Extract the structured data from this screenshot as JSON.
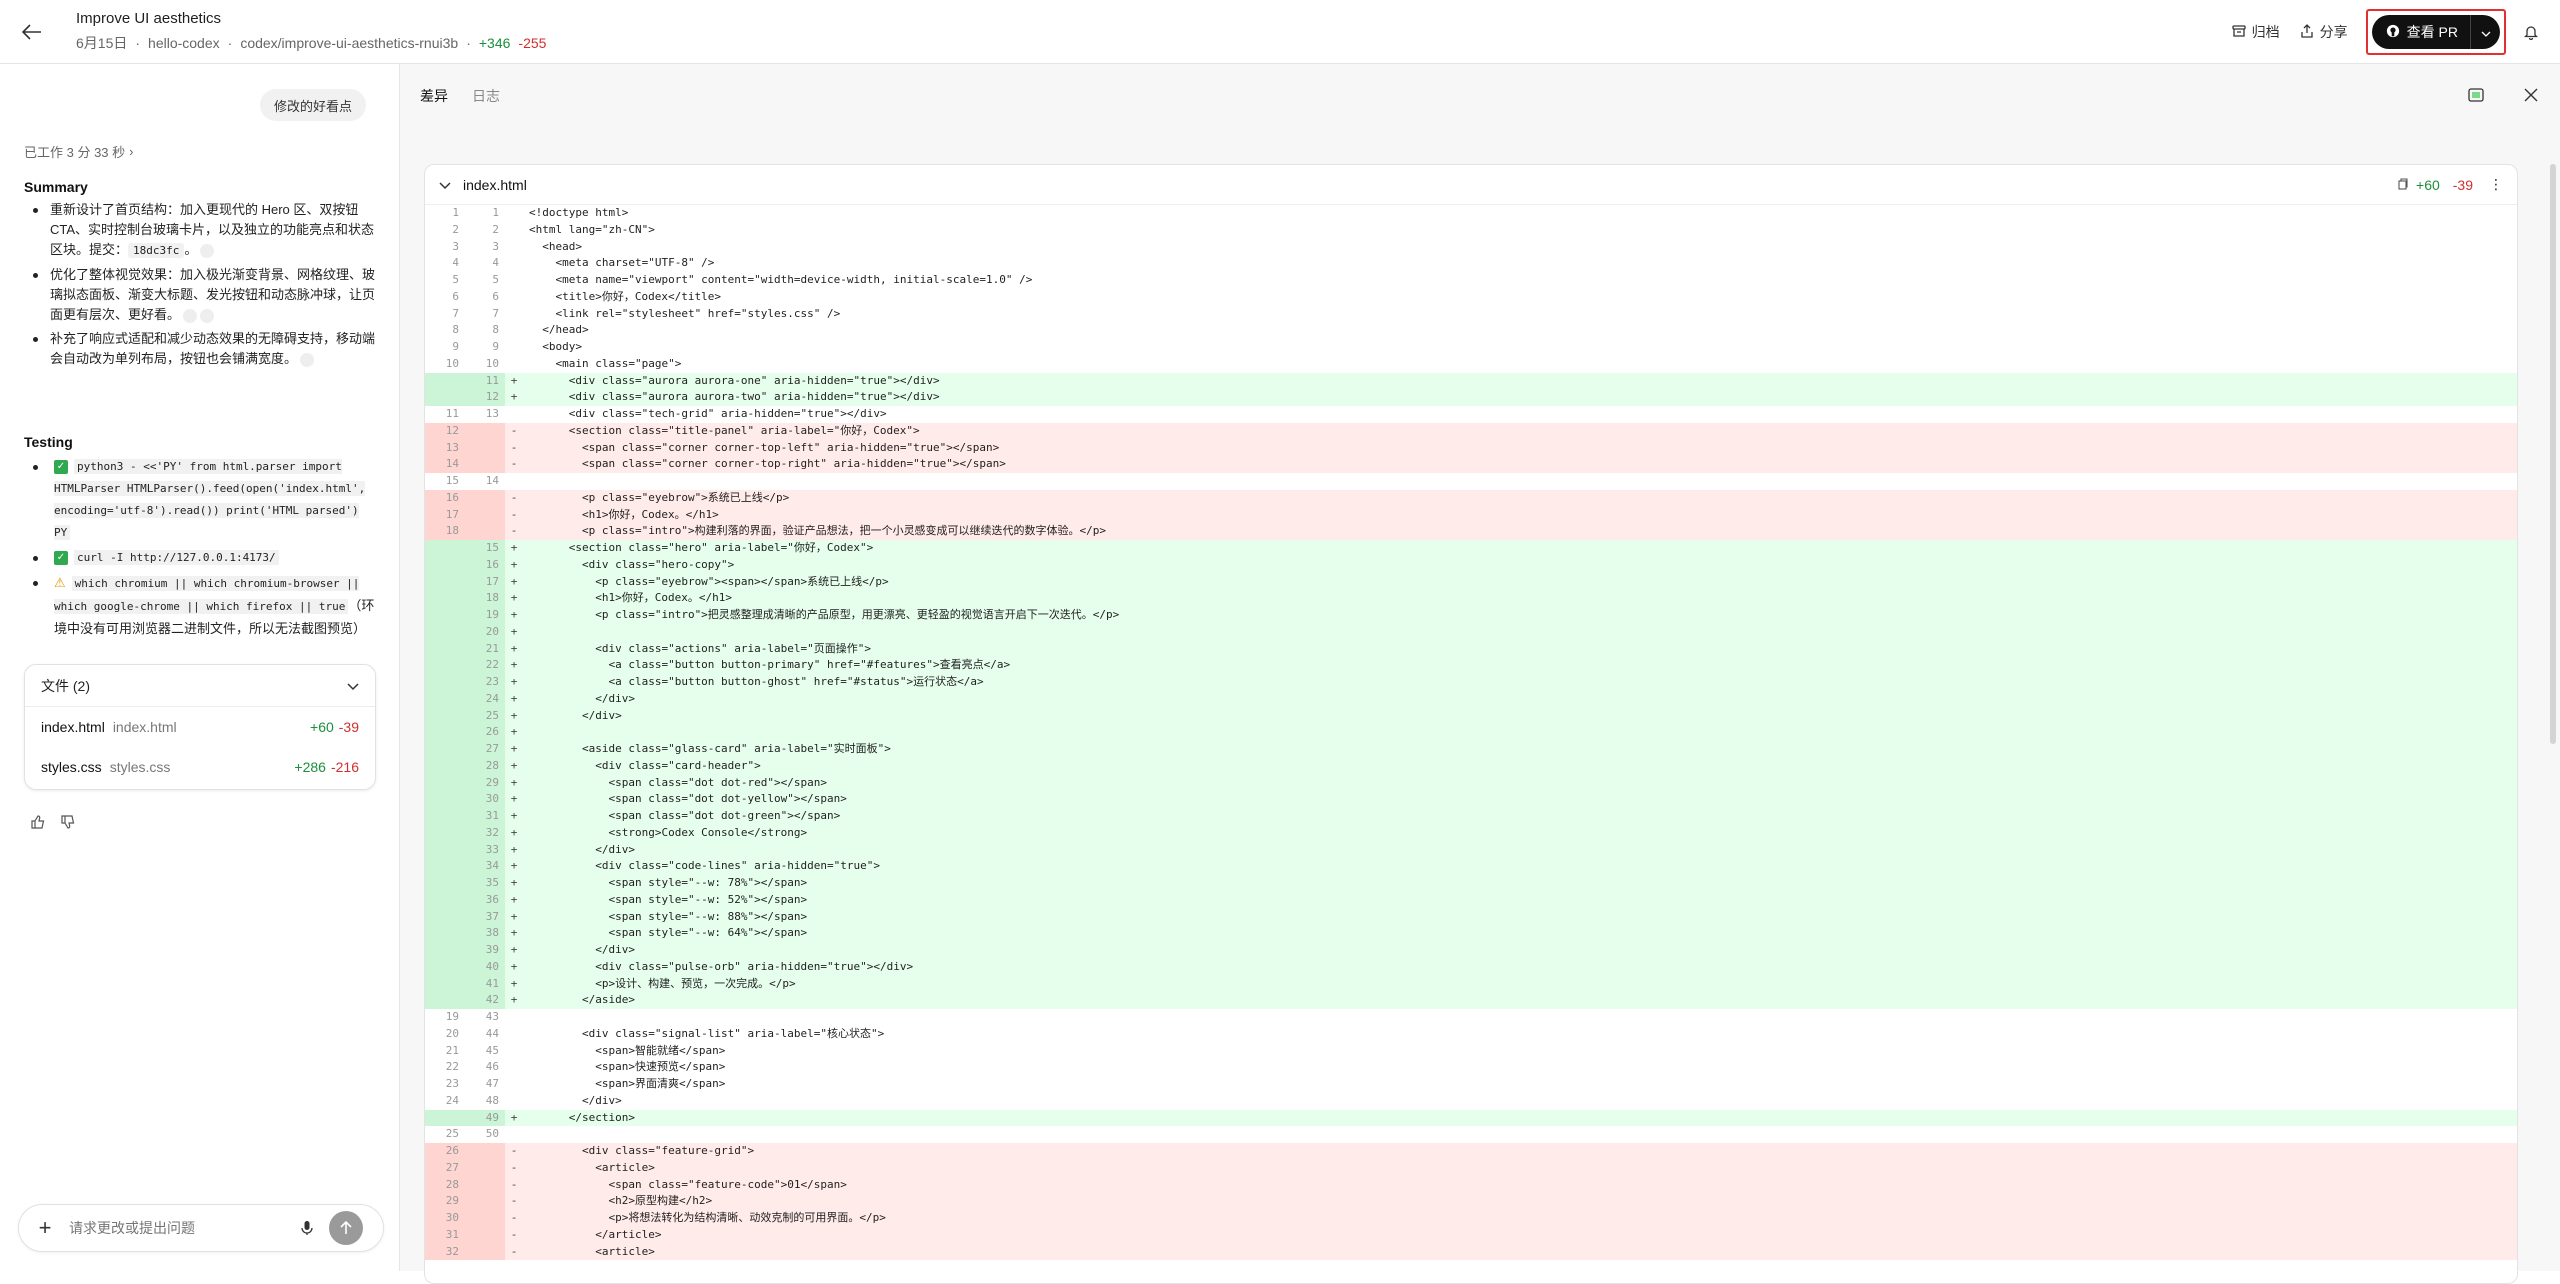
{
  "header": {
    "title": "Improve UI aesthetics",
    "date": "6月15日",
    "repo": "hello-codex",
    "branch": "codex/improve-ui-aesthetics-rnui3b",
    "additions": "+346",
    "deletions": "-255",
    "archive_label": "归档",
    "share_label": "分享",
    "pr_label": "查看 PR"
  },
  "left": {
    "prompt_chip": "修改的好看点",
    "worked": "已工作 3 分 33 秒",
    "summary_title": "Summary",
    "summary_items": [
      {
        "text": "重新设计了首页结构：加入更现代的 Hero 区、双按钮 CTA、实时控制台玻璃卡片，以及独立的功能亮点和状态区块。提交：",
        "code": "18dc3fc",
        "tail": "。"
      },
      {
        "text": "优化了整体视觉效果：加入极光渐变背景、网格纹理、玻璃拟态面板、渐变大标题、发光按钮和动态脉冲球，让页面更有层次、更好看。"
      },
      {
        "text": "补充了响应式适配和减少动态效果的无障碍支持，移动端会自动改为单列布局，按钮也会铺满宽度。"
      }
    ],
    "testing_title": "Testing",
    "testing_items": [
      {
        "status": "pass",
        "code": "python3 - <<'PY' from html.parser import HTMLParser HTMLParser().feed(open('index.html', encoding='utf-8').read()) print('HTML parsed') PY"
      },
      {
        "status": "pass",
        "code": "curl -I http://127.0.0.1:4173/"
      },
      {
        "status": "warn",
        "code": "which chromium || which chromium-browser || which google-chrome || which firefox || true",
        "note": "（环境中没有可用浏览器二进制文件，所以无法截图预览）"
      }
    ],
    "files_title": "文件 (2)",
    "files": [
      {
        "name": "index.html",
        "path": "index.html",
        "add": "+60",
        "del": "-39"
      },
      {
        "name": "styles.css",
        "path": "styles.css",
        "add": "+286",
        "del": "-216"
      }
    ],
    "composer_placeholder": "请求更改或提出问题"
  },
  "right": {
    "tabs": [
      "差异",
      "日志"
    ],
    "diff_file": "index.html",
    "diff_add": "+60",
    "diff_del": "-39",
    "lines": [
      {
        "t": "ctx",
        "a": "1",
        "b": "1",
        "c": "<!doctype html>"
      },
      {
        "t": "ctx",
        "a": "2",
        "b": "2",
        "c": "<html lang=\"zh-CN\">"
      },
      {
        "t": "ctx",
        "a": "3",
        "b": "3",
        "c": "  <head>"
      },
      {
        "t": "ctx",
        "a": "4",
        "b": "4",
        "c": "    <meta charset=\"UTF-8\" />"
      },
      {
        "t": "ctx",
        "a": "5",
        "b": "5",
        "c": "    <meta name=\"viewport\" content=\"width=device-width, initial-scale=1.0\" />"
      },
      {
        "t": "ctx",
        "a": "6",
        "b": "6",
        "c": "    <title>你好，Codex</title>"
      },
      {
        "t": "ctx",
        "a": "7",
        "b": "7",
        "c": "    <link rel=\"stylesheet\" href=\"styles.css\" />"
      },
      {
        "t": "ctx",
        "a": "8",
        "b": "8",
        "c": "  </head>"
      },
      {
        "t": "ctx",
        "a": "9",
        "b": "9",
        "c": "  <body>"
      },
      {
        "t": "ctx",
        "a": "10",
        "b": "10",
        "c": "    <main class=\"page\">"
      },
      {
        "t": "add",
        "a": "",
        "b": "11",
        "c": "      <div class=\"aurora aurora-one\" aria-hidden=\"true\"></div>"
      },
      {
        "t": "add",
        "a": "",
        "b": "12",
        "c": "      <div class=\"aurora aurora-two\" aria-hidden=\"true\"></div>"
      },
      {
        "t": "ctx",
        "a": "11",
        "b": "13",
        "c": "      <div class=\"tech-grid\" aria-hidden=\"true\"></div>"
      },
      {
        "t": "del",
        "a": "12",
        "b": "",
        "c": "      <section class=\"title-panel\" aria-label=\"你好，Codex\">"
      },
      {
        "t": "del",
        "a": "13",
        "b": "",
        "c": "        <span class=\"corner corner-top-left\" aria-hidden=\"true\"></span>"
      },
      {
        "t": "del",
        "a": "14",
        "b": "",
        "c": "        <span class=\"corner corner-top-right\" aria-hidden=\"true\"></span>"
      },
      {
        "t": "ctx",
        "a": "15",
        "b": "14",
        "c": ""
      },
      {
        "t": "del",
        "a": "16",
        "b": "",
        "c": "        <p class=\"eyebrow\">系统已上线</p>"
      },
      {
        "t": "del",
        "a": "17",
        "b": "",
        "c": "        <h1>你好，Codex。</h1>"
      },
      {
        "t": "del",
        "a": "18",
        "b": "",
        "c": "        <p class=\"intro\">构建利落的界面，验证产品想法，把一个小灵感变成可以继续迭代的数字体验。</p>"
      },
      {
        "t": "add",
        "a": "",
        "b": "15",
        "c": "      <section class=\"hero\" aria-label=\"你好，Codex\">"
      },
      {
        "t": "add",
        "a": "",
        "b": "16",
        "c": "        <div class=\"hero-copy\">"
      },
      {
        "t": "add",
        "a": "",
        "b": "17",
        "c": "          <p class=\"eyebrow\"><span></span>系统已上线</p>"
      },
      {
        "t": "add",
        "a": "",
        "b": "18",
        "c": "          <h1>你好，Codex。</h1>"
      },
      {
        "t": "add",
        "a": "",
        "b": "19",
        "c": "          <p class=\"intro\">把灵感整理成清晰的产品原型，用更漂亮、更轻盈的视觉语言开启下一次迭代。</p>"
      },
      {
        "t": "add",
        "a": "",
        "b": "20",
        "c": ""
      },
      {
        "t": "add",
        "a": "",
        "b": "21",
        "c": "          <div class=\"actions\" aria-label=\"页面操作\">"
      },
      {
        "t": "add",
        "a": "",
        "b": "22",
        "c": "            <a class=\"button button-primary\" href=\"#features\">查看亮点</a>"
      },
      {
        "t": "add",
        "a": "",
        "b": "23",
        "c": "            <a class=\"button button-ghost\" href=\"#status\">运行状态</a>"
      },
      {
        "t": "add",
        "a": "",
        "b": "24",
        "c": "          </div>"
      },
      {
        "t": "add",
        "a": "",
        "b": "25",
        "c": "        </div>"
      },
      {
        "t": "add",
        "a": "",
        "b": "26",
        "c": ""
      },
      {
        "t": "add",
        "a": "",
        "b": "27",
        "c": "        <aside class=\"glass-card\" aria-label=\"实时面板\">"
      },
      {
        "t": "add",
        "a": "",
        "b": "28",
        "c": "          <div class=\"card-header\">"
      },
      {
        "t": "add",
        "a": "",
        "b": "29",
        "c": "            <span class=\"dot dot-red\"></span>"
      },
      {
        "t": "add",
        "a": "",
        "b": "30",
        "c": "            <span class=\"dot dot-yellow\"></span>"
      },
      {
        "t": "add",
        "a": "",
        "b": "31",
        "c": "            <span class=\"dot dot-green\"></span>"
      },
      {
        "t": "add",
        "a": "",
        "b": "32",
        "c": "            <strong>Codex Console</strong>"
      },
      {
        "t": "add",
        "a": "",
        "b": "33",
        "c": "          </div>"
      },
      {
        "t": "add",
        "a": "",
        "b": "34",
        "c": "          <div class=\"code-lines\" aria-hidden=\"true\">"
      },
      {
        "t": "add",
        "a": "",
        "b": "35",
        "c": "            <span style=\"--w: 78%\"></span>"
      },
      {
        "t": "add",
        "a": "",
        "b": "36",
        "c": "            <span style=\"--w: 52%\"></span>"
      },
      {
        "t": "add",
        "a": "",
        "b": "37",
        "c": "            <span style=\"--w: 88%\"></span>"
      },
      {
        "t": "add",
        "a": "",
        "b": "38",
        "c": "            <span style=\"--w: 64%\"></span>"
      },
      {
        "t": "add",
        "a": "",
        "b": "39",
        "c": "          </div>"
      },
      {
        "t": "add",
        "a": "",
        "b": "40",
        "c": "          <div class=\"pulse-orb\" aria-hidden=\"true\"></div>"
      },
      {
        "t": "add",
        "a": "",
        "b": "41",
        "c": "          <p>设计、构建、预览，一次完成。</p>"
      },
      {
        "t": "add",
        "a": "",
        "b": "42",
        "c": "        </aside>"
      },
      {
        "t": "ctx",
        "a": "19",
        "b": "43",
        "c": ""
      },
      {
        "t": "ctx",
        "a": "20",
        "b": "44",
        "c": "        <div class=\"signal-list\" aria-label=\"核心状态\">"
      },
      {
        "t": "ctx",
        "a": "21",
        "b": "45",
        "c": "          <span>智能就绪</span>"
      },
      {
        "t": "ctx",
        "a": "22",
        "b": "46",
        "c": "          <span>快速预览</span>"
      },
      {
        "t": "ctx",
        "a": "23",
        "b": "47",
        "c": "          <span>界面清爽</span>"
      },
      {
        "t": "ctx",
        "a": "24",
        "b": "48",
        "c": "        </div>"
      },
      {
        "t": "add",
        "a": "",
        "b": "49",
        "c": "      </section>"
      },
      {
        "t": "ctx",
        "a": "25",
        "b": "50",
        "c": ""
      },
      {
        "t": "del",
        "a": "26",
        "b": "",
        "c": "        <div class=\"feature-grid\">"
      },
      {
        "t": "del",
        "a": "27",
        "b": "",
        "c": "          <article>"
      },
      {
        "t": "del",
        "a": "28",
        "b": "",
        "c": "            <span class=\"feature-code\">01</span>"
      },
      {
        "t": "del",
        "a": "29",
        "b": "",
        "c": "            <h2>原型构建</h2>"
      },
      {
        "t": "del",
        "a": "30",
        "b": "",
        "c": "            <p>将想法转化为结构清晰、动效克制的可用界面。</p>"
      },
      {
        "t": "del",
        "a": "31",
        "b": "",
        "c": "          </article>"
      },
      {
        "t": "del",
        "a": "32",
        "b": "",
        "c": "          <article>"
      }
    ]
  },
  "colors": {
    "add_bg": "#e6ffec",
    "del_bg": "#ffebe9",
    "add_text": "#1a8f3c",
    "del_text": "#d12f2f",
    "pr_button": "#111111",
    "highlight": "#e03131"
  }
}
